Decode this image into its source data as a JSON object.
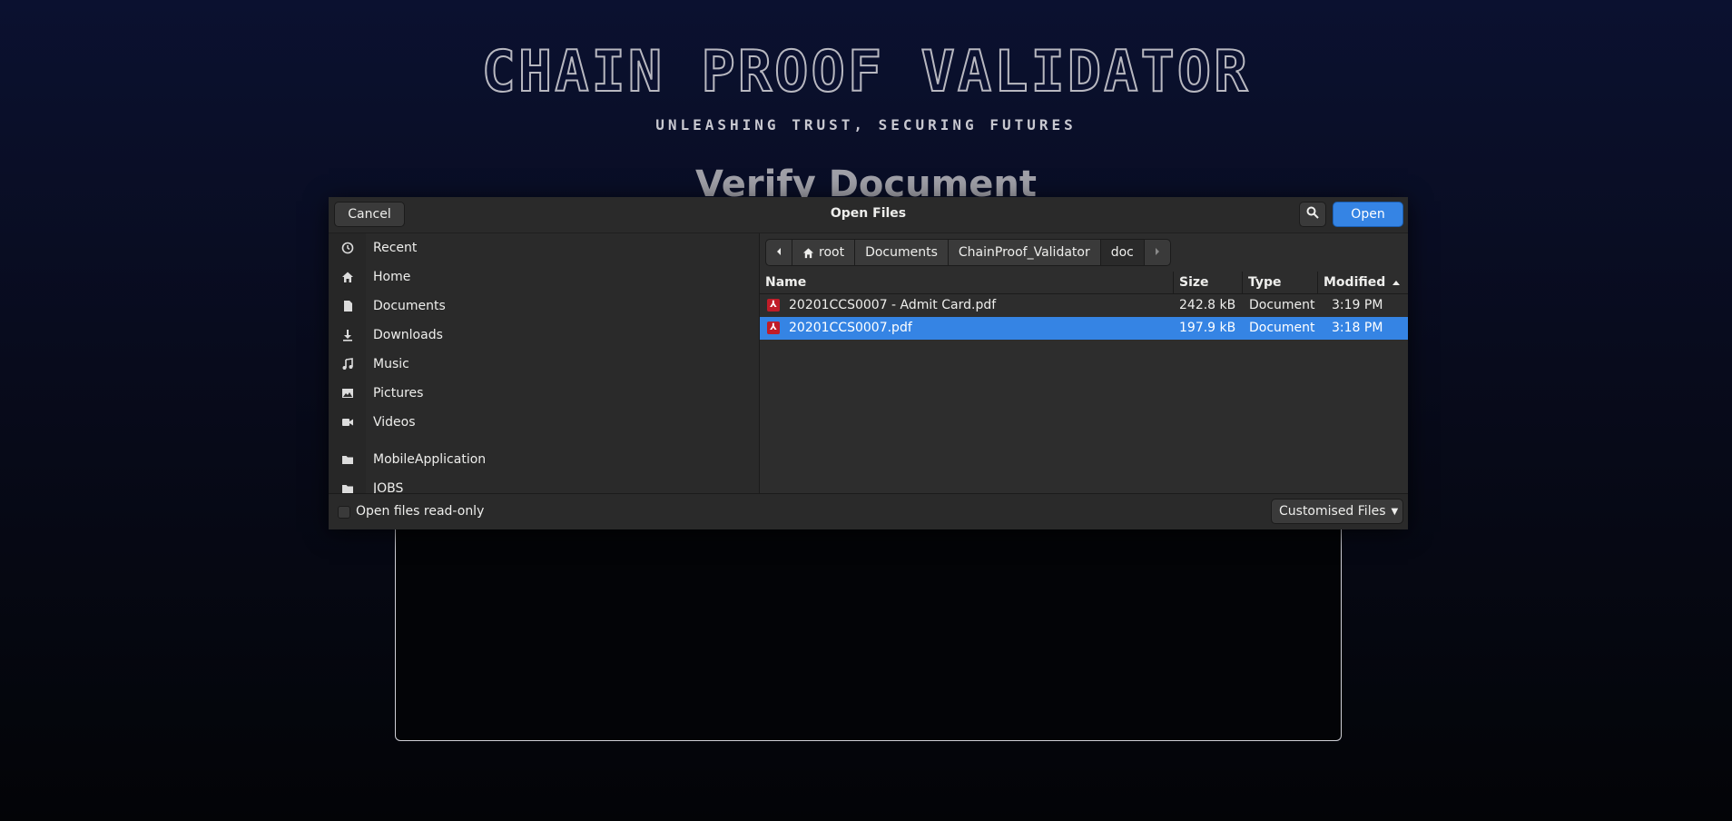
{
  "background": {
    "title": "CHAIN PROOF VALIDATOR",
    "subtitle": "UNLEASHING TRUST, SECURING FUTURES",
    "heading": "Verify Document"
  },
  "dialog": {
    "title": "Open Files",
    "cancel_label": "Cancel",
    "open_label": "Open",
    "accent_color": "#3584e4"
  },
  "sidebar": {
    "items": [
      {
        "label": "Recent",
        "icon": "clock-icon"
      },
      {
        "label": "Home",
        "icon": "home-icon"
      },
      {
        "label": "Documents",
        "icon": "document-icon"
      },
      {
        "label": "Downloads",
        "icon": "download-icon"
      },
      {
        "label": "Music",
        "icon": "music-icon"
      },
      {
        "label": "Pictures",
        "icon": "picture-icon"
      },
      {
        "label": "Videos",
        "icon": "video-icon"
      },
      {
        "label": "MobileApplication",
        "icon": "folder-icon"
      },
      {
        "label": "JOBS",
        "icon": "folder-icon"
      }
    ]
  },
  "pathbar": {
    "crumbs": [
      "root",
      "Documents",
      "ChainProof_Validator",
      "doc"
    ]
  },
  "filelist": {
    "columns": {
      "name": "Name",
      "size": "Size",
      "type": "Type",
      "modified": "Modified"
    },
    "rows": [
      {
        "name": "20201CCS0007 - Admit Card.pdf",
        "size": "242.8 kB",
        "type": "Document",
        "modified": "3:19 PM"
      },
      {
        "name": "20201CCS0007.pdf",
        "size": "197.9 kB",
        "type": "Document",
        "modified": "3:18 PM"
      }
    ]
  },
  "footer": {
    "readonly_label": "Open files read-only",
    "filter_label": "Customised Files"
  }
}
